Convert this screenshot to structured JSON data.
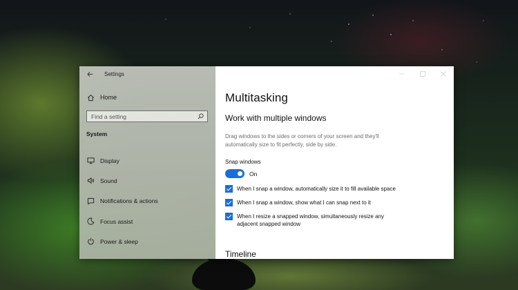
{
  "window": {
    "title": "Settings"
  },
  "sidebar": {
    "home_label": "Home",
    "search_placeholder": "Find a setting",
    "section_title": "System",
    "items": [
      {
        "label": "Display",
        "icon": "display-icon"
      },
      {
        "label": "Sound",
        "icon": "speaker-icon"
      },
      {
        "label": "Notifications & actions",
        "icon": "notifications-icon"
      },
      {
        "label": "Focus assist",
        "icon": "moon-icon"
      },
      {
        "label": "Power & sleep",
        "icon": "power-icon"
      }
    ]
  },
  "main": {
    "page_title": "Multitasking",
    "section_title": "Work with multiple windows",
    "description": "Drag windows to the sides or corners of your screen and they'll automatically size to fit perfectly, side by side.",
    "snap_label": "Snap windows",
    "snap_state": "On",
    "checkboxes": [
      {
        "label": "When I snap a window, automatically size it to fill available space",
        "checked": true
      },
      {
        "label": "When I snap a window, show what I can snap next to it",
        "checked": true
      },
      {
        "label": "When I resize a snapped window, simultaneously resize any adjacent snapped window",
        "checked": true
      }
    ],
    "next_section": "Timeline"
  },
  "colors": {
    "accent": "#1a6fd6",
    "sidebar_bg": "#b6bcb0",
    "content_bg": "#ffffff"
  }
}
